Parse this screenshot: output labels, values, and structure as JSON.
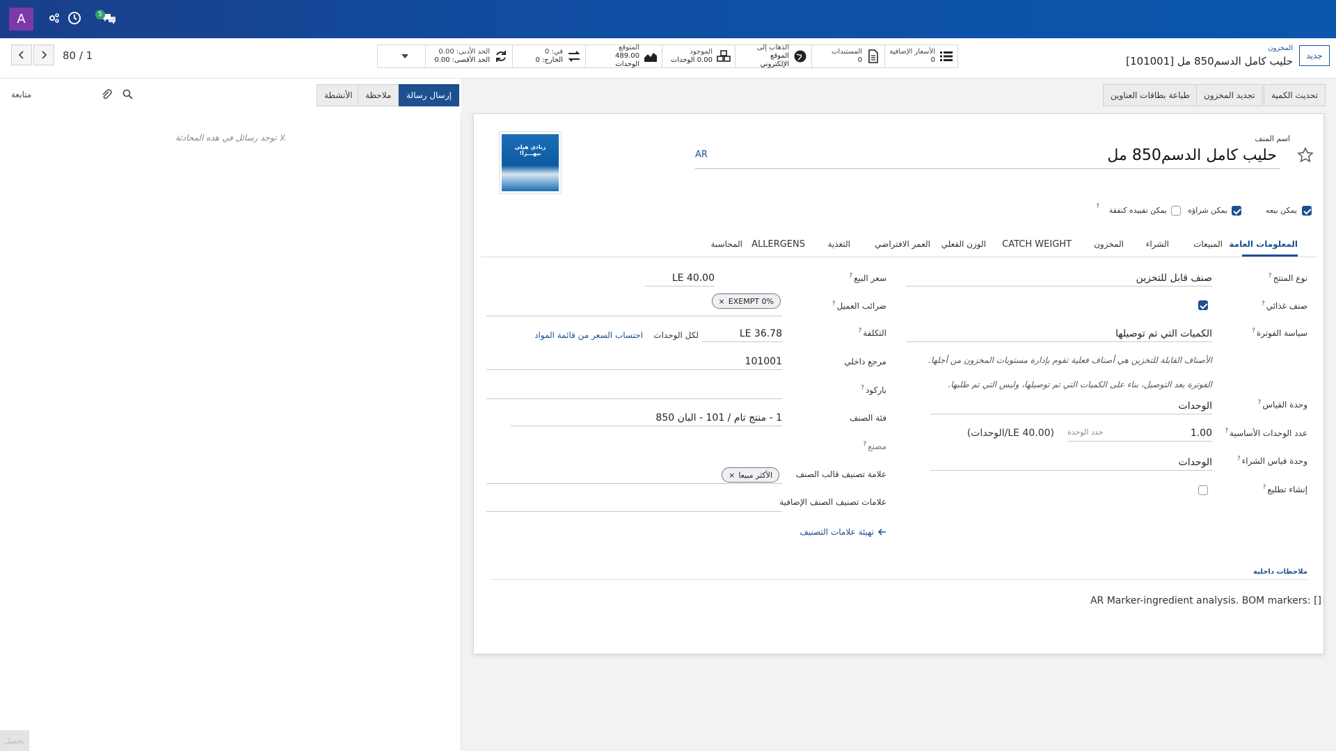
{
  "nav": {
    "avatar": "A",
    "badge": "5"
  },
  "pager": {
    "text": "80 / 1"
  },
  "breadcrumb": {
    "new_button": "جديد",
    "parent": "المخزون",
    "title": "[101001] حليب كامل الدسم850 مل"
  },
  "stats": [
    {
      "icon": "list-icon",
      "name": "stat-extra-prices",
      "l1": "الأسعار الإضافية",
      "l2": "0"
    },
    {
      "icon": "document-icon",
      "name": "stat-documents",
      "l1": "المستندات",
      "l2": "0"
    },
    {
      "icon": "globe-icon",
      "name": "stat-go-website",
      "l1": "الذهاب إلى",
      "l2": "الموقع الإلكتروني"
    },
    {
      "icon": "cubes-icon",
      "name": "stat-on-hand",
      "l1": "الموجود",
      "l2": "0.00 الوحدات"
    },
    {
      "icon": "area-chart-icon",
      "name": "stat-forecast",
      "l1": "المتوقع",
      "l2": "489.00 الوحدات"
    },
    {
      "icon": "exchange-icon",
      "name": "stat-in-out",
      "l1": "في: 0",
      "l2": "الخارج: 0"
    },
    {
      "icon": "refresh-icon",
      "name": "stat-min-max",
      "l1": "الحد الأدنى: 0.00",
      "l2": "الحد الأقصى: 0.00"
    }
  ],
  "actions": {
    "update_qty": "تحديث الكمية",
    "replenish": "تجديد المخزون",
    "print_labels": "طباعة بطاقات العناوين"
  },
  "chatter": {
    "send_message": "إرسال رسالة",
    "log_note": "ملاحظة",
    "activities": "الأنشطة",
    "follow": "متابعة",
    "empty": "لا توجد رسائل في هذه المحادثة.",
    "load": "تحميل"
  },
  "product": {
    "name_label": "اسم المنف",
    "name": "حليب كامل الدسم850 مل",
    "lang": "AR",
    "image_text": "زبادي هيلي بيهـــزأ!",
    "checks": {
      "sale": "يمكن بيعه",
      "purchase": "يمكن شراؤه",
      "expense": "يمكن تقييده كنفقة"
    }
  },
  "tabs": [
    "المعلومات العامة",
    "المبيعات",
    "الشراء",
    "المخزون",
    "CATCH WEIGHT",
    "الوزن الفعلي",
    "العمر الافتراضي",
    "التغذية",
    "ALLERGENS",
    "المحاسبة"
  ],
  "left": {
    "type_label": "نوع المنتج",
    "type_value": "صنف قابل للتخزين",
    "food_label": "صنف غذائي",
    "invoice_label": "سياسة الفوترة",
    "invoice_value": "الكميات التي تم توصيلها",
    "help1": "الأصناف القابلة للتخزين هي أصناف فعلية تقوم بإدارة مستويات المخزون من أجلها.",
    "help2": "الفوترة بعد التوصيل، بناء على الكميات التي تم توصيلها، وليس التي تم طلبها.",
    "uom_label": "وحدة القياس",
    "uom_value": "الوحدات",
    "base_label": "عدد الوحدات الأساسية",
    "base_value": "1.00",
    "base_hint": "حدد الوحدة",
    "base_extra": "(40.00 LE/الوحدات)",
    "puom_label": "وحدة قياس الشراء",
    "puom_value": "الوحدات",
    "pack_label": "إنشاء تطليع"
  },
  "right": {
    "price_label": "سعر البيع",
    "price_value": "LE 40.00",
    "tax_label": "ضرائب العميل",
    "tax_tag": "EXEMPT 0%",
    "cost_label": "التكلفة",
    "cost_value": "LE 36.78",
    "cost_unit": "لكل الوحدات",
    "cost_link": "احتساب السعر من قائمة المواد",
    "ref_label": "مرجع داخلي",
    "ref_value": "101001",
    "barcode_label": "باركود",
    "barcode_value": "",
    "categ_label": "فئة الصنف",
    "categ_value": "1 - منتج تام / 101 - البان 850",
    "mfr_label": "مصنع",
    "tmpl_tag_label": "علامة تصنيف قالب الصنف",
    "tmpl_tag": "الأكثر مبيعا",
    "extra_tag_label": "علامات تصنيف الصنف الإضافية",
    "config_link": "تهيئة علامات التصنيف"
  },
  "notes": {
    "label": "ملاحظات داخلية",
    "text": "AR Marker-ingredient analysis. BOM markers: []"
  }
}
